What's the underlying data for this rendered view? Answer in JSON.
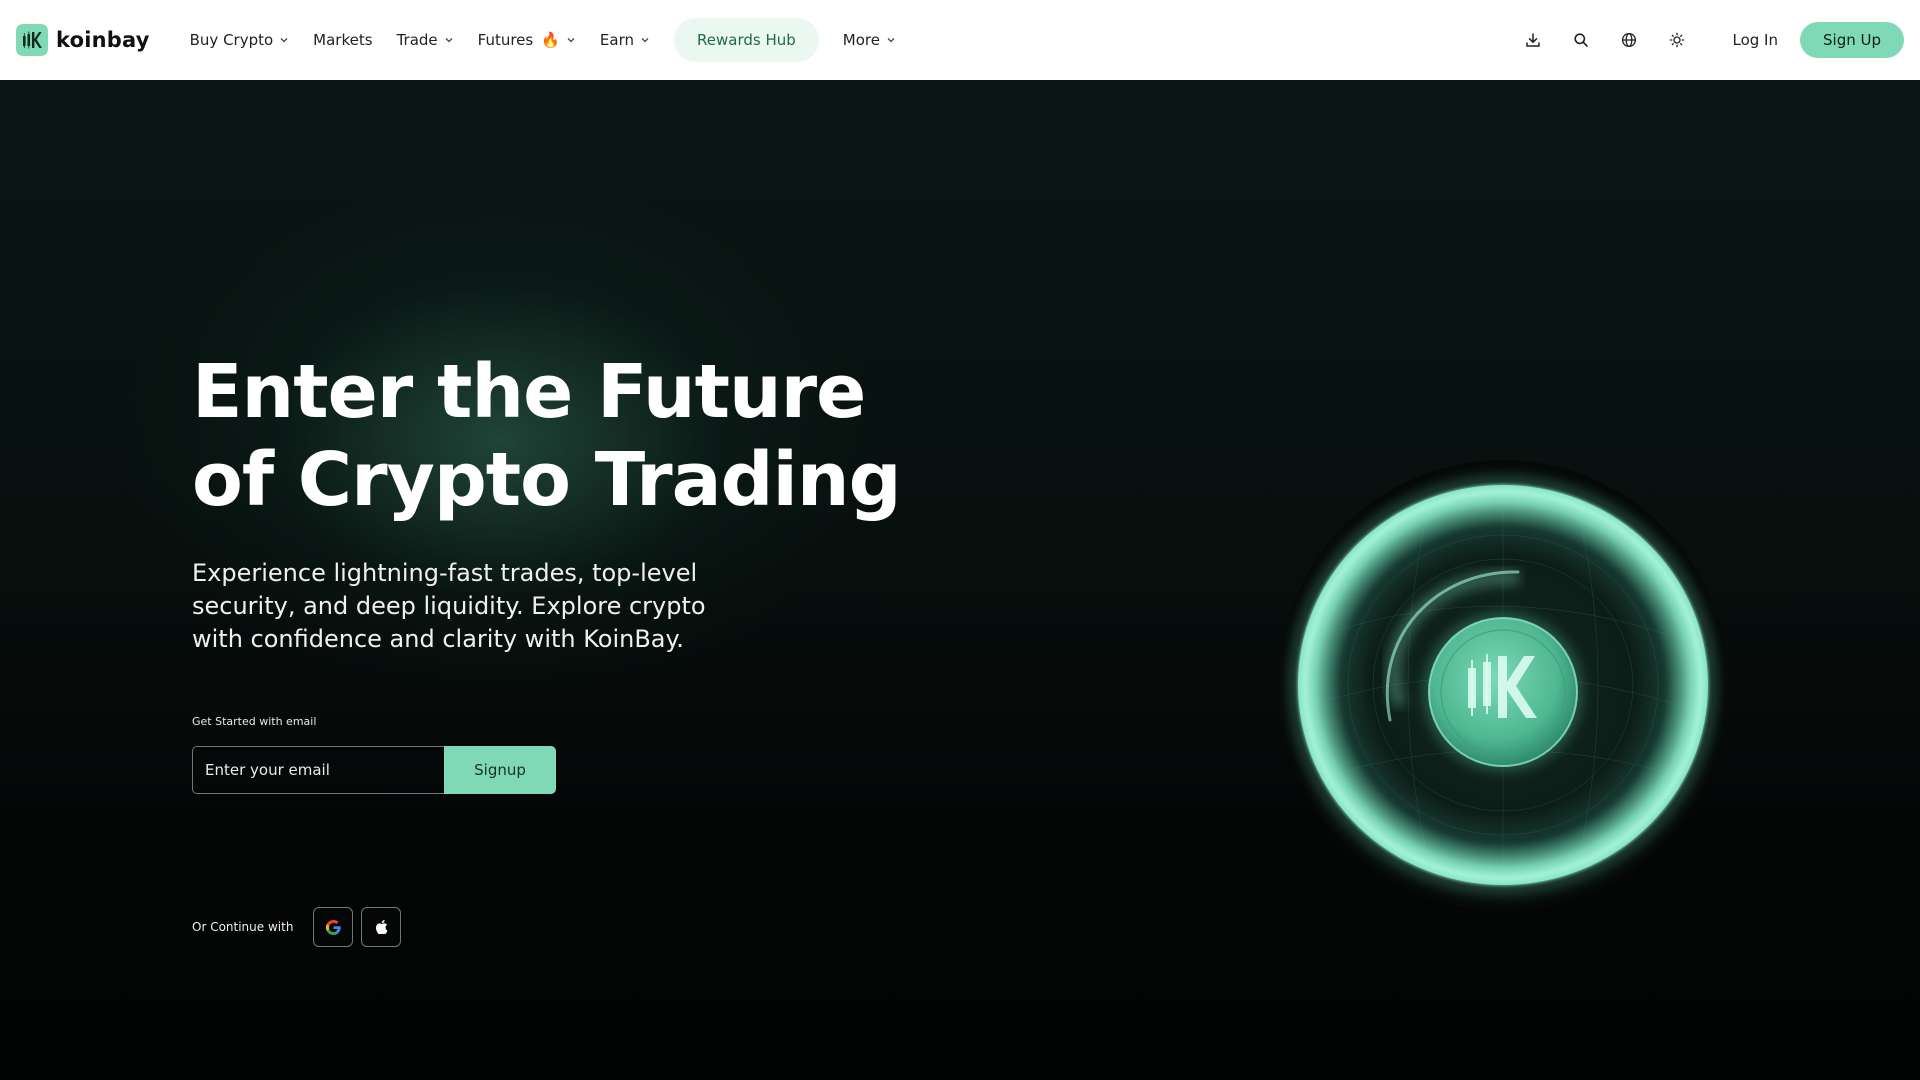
{
  "brand": {
    "name": "koinbay"
  },
  "nav": {
    "items": [
      {
        "label": "Buy Crypto",
        "dropdown": true
      },
      {
        "label": "Markets",
        "dropdown": false
      },
      {
        "label": "Trade",
        "dropdown": true
      },
      {
        "label": "Futures",
        "dropdown": true,
        "badge": "🔥"
      },
      {
        "label": "Earn",
        "dropdown": true
      }
    ],
    "rewards_label": "Rewards Hub",
    "more_label": "More",
    "icons": [
      "download-icon",
      "search-icon",
      "globe-icon",
      "theme-sun-icon"
    ],
    "login_label": "Log In",
    "signup_label": "Sign Up"
  },
  "hero": {
    "title_line1": "Enter the Future",
    "title_line2": "of Crypto Trading",
    "subtitle": "Experience lightning-fast trades, top-level security, and deep liquidity. Explore crypto with confidence and clarity with KoinBay.",
    "started_label": "Get Started with email",
    "email_placeholder": "Enter your email",
    "signup_button": "Signup",
    "continue_label": "Or Continue with",
    "social": [
      "google-icon",
      "apple-icon"
    ]
  },
  "colors": {
    "accent": "#7fd9b6",
    "rewards_bg": "#eaf8f1",
    "hero_bg": "#08110f"
  }
}
